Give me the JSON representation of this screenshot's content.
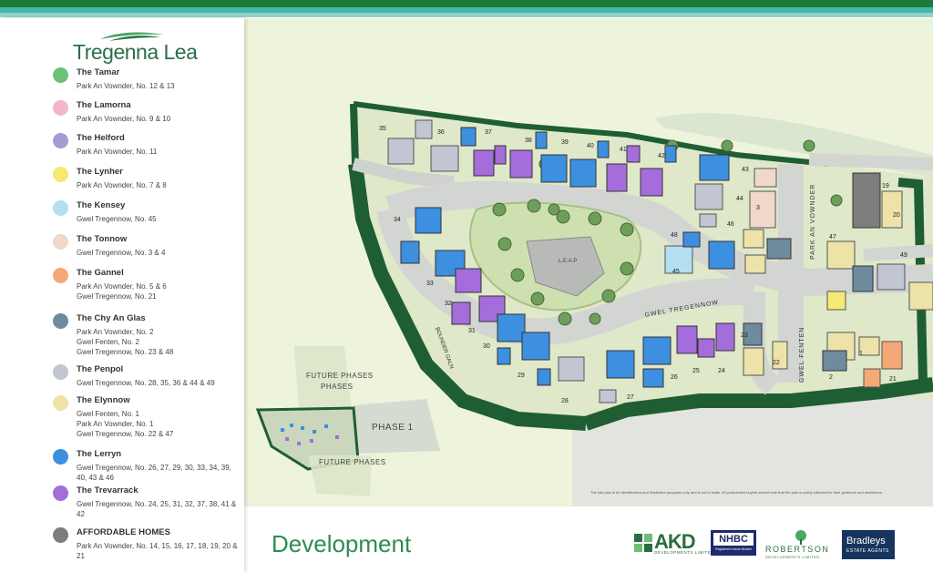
{
  "brand": {
    "name": "Tregenna Lea"
  },
  "legend": [
    {
      "title": "The Tamar",
      "desc": "Park An Vownder, No. 12 & 13",
      "color": "#6cc17a"
    },
    {
      "title": "The Lamorna",
      "desc": "Park An Vownder, No. 9 & 10",
      "color": "#f4b6cf"
    },
    {
      "title": "The Helford",
      "desc": "Park An Vownder, No. 11",
      "color": "#a89bd4"
    },
    {
      "title": "The Lynher",
      "desc": "Park An Vownder, No. 7 & 8",
      "color": "#f5e873"
    },
    {
      "title": "The Kensey",
      "desc": "Gwel Tregennow, No. 45",
      "color": "#b3dff0"
    },
    {
      "title": "The Tonnow",
      "desc": "Gwel Tregennow, No. 3 & 4",
      "color": "#f0d9c8"
    },
    {
      "title": "The Gannel",
      "desc": "Park An Vownder, No. 5 & 6\nGwel Tregennow, No. 21",
      "color": "#f5a877"
    },
    {
      "title": "The Chy An Glas",
      "desc": "Park An Vownder, No. 2\nGwel Fenten, No. 2\nGwel Tregennow, No. 23 & 48",
      "color": "#6f8c9e"
    },
    {
      "title": "The Penpol",
      "desc": "Gwel Tregennow, No. 28, 35, 36 & 44 & 49",
      "color": "#c2c5d2"
    },
    {
      "title": "The Elynnow",
      "desc": "Gwel Fenten, No. 1\nPark An Vownder, No. 1\nGwel Tregennow, No. 22 & 47",
      "color": "#ede3a8"
    },
    {
      "title": "The Lerryn",
      "desc": "Gwel Tregennow, No. 26, 27, 29, 30, 33, 34, 39, 40, 43 & 46",
      "color": "#3d8fe0"
    },
    {
      "title": "The Trevarrack",
      "desc": "Gwel Tregennow, No. 24, 25, 31, 32, 37, 38, 41 & 42",
      "color": "#a56ddb"
    },
    {
      "title": "AFFORDABLE HOMES",
      "desc": "Park An Vownder, No. 14, 15, 16, 17, 18, 19, 20 & 21",
      "color": "#7d7d7d"
    }
  ],
  "map": {
    "streets": [
      "GWEL TREGENNOW",
      "PARK AN VOWNDER",
      "GWEL FENTEN",
      "BOUNDER GALN",
      "L.E.A.P"
    ],
    "inset": {
      "future_top": "FUTURE PHASES",
      "phase1": "PHASE 1",
      "future_bottom": "FUTURE PHASES"
    },
    "disclaimer": "The site plan is for identification and illustrative purposes only and is not to scale. All prospective buyers should note that the plan is solely intended for their guidance and assistance.",
    "plot_labels": [
      {
        "n": "35"
      },
      {
        "n": "36"
      },
      {
        "n": "37"
      },
      {
        "n": "38"
      },
      {
        "n": "39"
      },
      {
        "n": "40"
      },
      {
        "n": "41"
      },
      {
        "n": "42"
      },
      {
        "n": "43"
      },
      {
        "n": "44"
      },
      {
        "n": "34"
      },
      {
        "n": "33"
      },
      {
        "n": "32"
      },
      {
        "n": "31"
      },
      {
        "n": "30"
      },
      {
        "n": "29"
      },
      {
        "n": "28"
      },
      {
        "n": "27"
      },
      {
        "n": "26"
      },
      {
        "n": "25"
      },
      {
        "n": "24"
      },
      {
        "n": "23"
      },
      {
        "n": "22"
      },
      {
        "n": "48"
      },
      {
        "n": "46"
      },
      {
        "n": "45"
      },
      {
        "n": "47"
      },
      {
        "n": "49"
      },
      {
        "n": "21"
      },
      {
        "n": "20"
      },
      {
        "n": "19"
      },
      {
        "n": "1"
      },
      {
        "n": "2"
      },
      {
        "n": "3"
      }
    ]
  },
  "footer": {
    "title": "Development",
    "akd": {
      "name": "AKD",
      "sub": "DEVELOPMENTS LIMITED"
    },
    "nhbc": {
      "name": "NHBC",
      "sub": "Registered House Builder"
    },
    "robertson": {
      "name": "ROBERTSON",
      "sub": "DEVELOPMENTS LIMITED"
    },
    "bradleys": {
      "name": "Bradleys",
      "sub": "ESTATE AGENTS"
    }
  }
}
